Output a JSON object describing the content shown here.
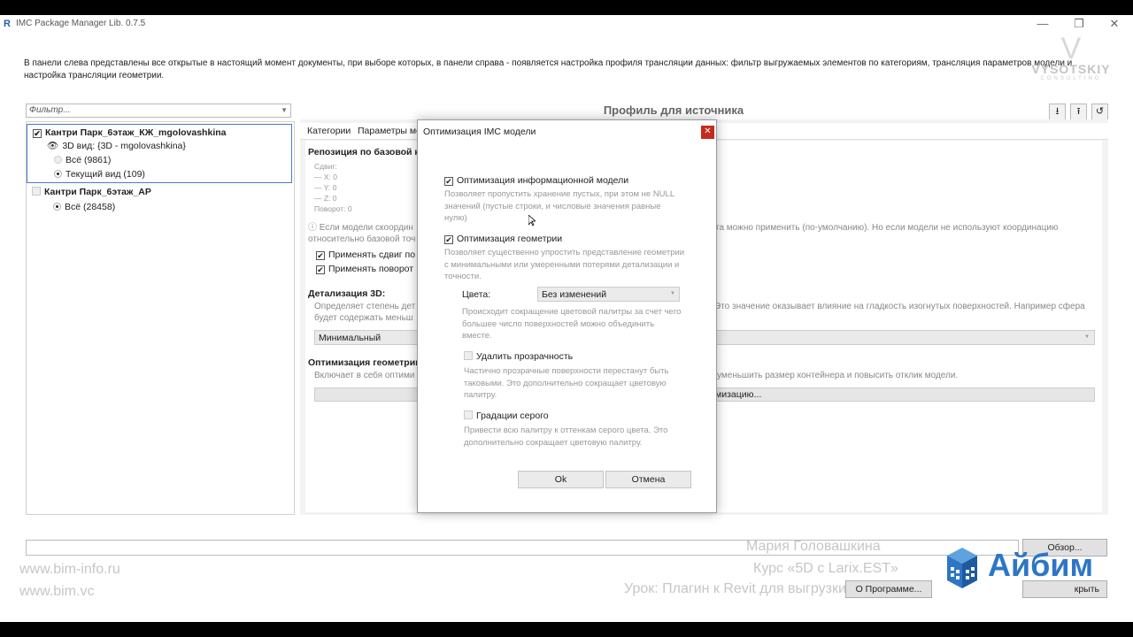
{
  "window": {
    "title": "IMC Package Manager Lib. 0.7.5",
    "app_icon": "R",
    "controls": {
      "minimize": "—",
      "maximize": "❐",
      "close": "✕"
    }
  },
  "description": "В панели слева представлены все открытые в настоящий момент документы, при выборе которых, в панели справа - появляется настройка профиля трансляции данных: фильтр выгружаемых элементов по категориям, трансляция параметров модели и настройка трансляции геометрии.",
  "watermark_logo": {
    "mark": "V",
    "name": "VYSOTSKIY",
    "sub": "CONSULTING"
  },
  "filter": {
    "placeholder": "Фильтр...",
    "arrow": "▼"
  },
  "documents": [
    {
      "name": "Кантри Парк_6этаж_КЖ_mgolovashkina",
      "checked": true,
      "view": "3D вид: {3D - mgolovashkina}",
      "options": [
        {
          "label": "Всё (9861)",
          "selected": false
        },
        {
          "label": "Текущий вид (109)",
          "selected": true
        }
      ]
    },
    {
      "name": "Кантри Парк_6этаж_АР",
      "checked": false,
      "options": [
        {
          "label": "Всё (28458)",
          "selected": true
        }
      ]
    }
  ],
  "profile": {
    "title": "Профиль для источника",
    "toolbar": {
      "import": "⭳",
      "export": "⭱",
      "reset": "↺"
    },
    "tabs": [
      "Категории",
      "Параметры мо"
    ],
    "reposition": {
      "heading": "Репозиция по базовой ко",
      "shift_label": "Сдвиг:",
      "x": "— X: 0",
      "y": "— Y: 0",
      "z": "— Z: 0",
      "rotation": "Поворот: 0",
      "hint_left": "ⓘ Если модели скоордин",
      "hint_left2": "относительно базовой точ",
      "hint_right": "та можно применить (по-умолчанию). Но если модели не используют координацию",
      "apply_shift": "Применять сдвиг по",
      "apply_rotation": "Применять поворот"
    },
    "detail": {
      "heading": "Детализация 3D:",
      "hint_left": "Определяет степень дет",
      "hint_left2": "будет содержать меньш",
      "hint_right": "Это значение оказывает влияние на гладкость изогнутых поверхностей. Например сфера",
      "value": "Минимальный"
    },
    "optimization": {
      "heading": "Оптимизация геометрии",
      "hint_left": "Включает в себя оптими",
      "hint_right": "уменьшить размер контейнера и повысить отклик модели.",
      "button_tail": "мизацию..."
    }
  },
  "bottom": {
    "browse": "Обзор...",
    "about": "О Программе...",
    "close_partial": "крыть"
  },
  "overlay": {
    "site1": "www.bim-info.ru",
    "site2": "www.bim.vc",
    "author": "Мария Головашкина",
    "course": "Курс «5D с Larix.EST»",
    "lesson": "Урок: Плагин к Revit для выгрузки",
    "brand": "Айбим"
  },
  "modal": {
    "title": "Оптимизация IMC модели",
    "close": "✕",
    "info_opt": {
      "label": "Оптимизация информационной модели",
      "checked": true,
      "hint": "Позволяет пропустить хранение пустых, при этом не NULL значений (пустые строки, и числовые значения равные нулю)"
    },
    "geom_opt": {
      "label": "Оптимизация геометрии",
      "checked": true,
      "hint": "Позволяет существенно упростить представление геометрии с минимальными или умеренными потерями детализации и точности."
    },
    "colors": {
      "label": "Цвета:",
      "value": "Без изменений",
      "hint": "Происходит сокращение цветовой палитры за счет чего большее число поверхностей можно объединить вместе."
    },
    "transparency": {
      "label": "Удалить прозрачность",
      "checked": false,
      "hint": "Частично прозрачные поверхности перестанут быть таковыми. Это дополнительно сокращает цветовую палитру."
    },
    "grayscale": {
      "label": "Градации серого",
      "checked": false,
      "hint": "Привести всю палитру к оттенкам серого цвета. Это дополнительно сокращает цветовую палитру."
    },
    "ok": "Ok",
    "cancel": "Отмена"
  }
}
